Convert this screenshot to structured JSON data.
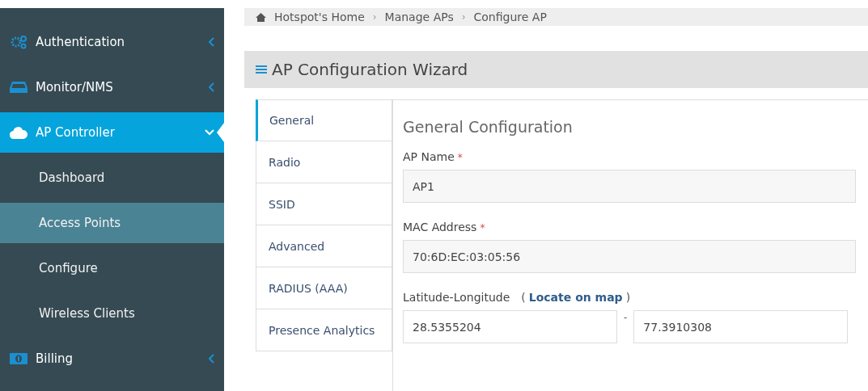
{
  "sidebar": {
    "items": [
      {
        "label": "Authentication",
        "kind": "gears",
        "expanded": false,
        "selected": false
      },
      {
        "label": "Monitor/NMS",
        "kind": "inbox",
        "expanded": false,
        "selected": false
      },
      {
        "label": "AP Controller",
        "kind": "cloud",
        "expanded": true,
        "selected": true,
        "children": [
          {
            "label": "Dashboard",
            "selected": false
          },
          {
            "label": "Access Points",
            "selected": true
          },
          {
            "label": "Configure",
            "selected": false
          },
          {
            "label": "Wireless Clients",
            "selected": false
          }
        ]
      },
      {
        "label": "Billing",
        "kind": "money",
        "expanded": false,
        "selected": false
      }
    ]
  },
  "breadcrumb": {
    "items": [
      "Hotspot's Home",
      "Manage APs",
      "Configure AP"
    ],
    "separator": "›"
  },
  "panel": {
    "title": "AP Configuration Wizard",
    "tabs": [
      {
        "label": "General",
        "selected": true
      },
      {
        "label": "Radio",
        "selected": false
      },
      {
        "label": "SSID",
        "selected": false
      },
      {
        "label": "Advanced",
        "selected": false
      },
      {
        "label": "RADIUS (AAA)",
        "selected": false
      },
      {
        "label": "Presence Analytics",
        "selected": false
      }
    ],
    "section_title": "General Configuration",
    "fields": [
      {
        "label": "AP Name",
        "required_mark": "*",
        "value": "AP1"
      },
      {
        "label": "MAC Address",
        "required_mark": "*",
        "value": "70:6D:EC:03:05:56"
      }
    ],
    "location": {
      "label": "Latitude-Longitude",
      "open_paren": "(",
      "link": "Locate on map",
      "close_paren": ")",
      "separator": "-",
      "latitude": "28.5355204",
      "longitude": "77.3910308"
    }
  }
}
